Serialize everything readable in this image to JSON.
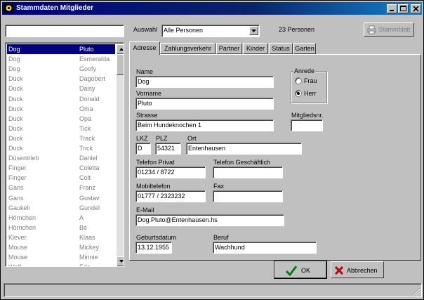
{
  "window": {
    "title": "Stammdaten Mitglieder"
  },
  "toolbar": {
    "search_value": "",
    "auswahl_label": "Auswahl",
    "auswahl_value": "Alle Personen",
    "count_text": "23 Personen",
    "stammblatt_label": "Stammblatt"
  },
  "list": {
    "rows": [
      {
        "last": "Dog",
        "first": "Pluto",
        "selected": true
      },
      {
        "last": "Dog",
        "first": "Esmeralda"
      },
      {
        "last": "Dog",
        "first": "Goofy"
      },
      {
        "last": "Duck",
        "first": "Dagobert"
      },
      {
        "last": "Duck",
        "first": "Daisy"
      },
      {
        "last": "Duck",
        "first": "Donald"
      },
      {
        "last": "Duck",
        "first": "Oma"
      },
      {
        "last": "Duck",
        "first": "Opa"
      },
      {
        "last": "Duck",
        "first": "Tick"
      },
      {
        "last": "Duck",
        "first": "Track"
      },
      {
        "last": "Duck",
        "first": "Trick"
      },
      {
        "last": "Düsentrieb",
        "first": "Daniel"
      },
      {
        "last": "Finger",
        "first": "Coletta"
      },
      {
        "last": "Finger",
        "first": "Colt"
      },
      {
        "last": "Gans",
        "first": "Franz"
      },
      {
        "last": "Gans",
        "first": "Gustav"
      },
      {
        "last": "Gaukeli",
        "first": "Gundel"
      },
      {
        "last": "Hörnchen",
        "first": "A"
      },
      {
        "last": "Hörnchen",
        "first": "Be"
      },
      {
        "last": "Klever",
        "first": "Klaas"
      },
      {
        "last": "Mouse",
        "first": "Mickey"
      },
      {
        "last": "Mouse",
        "first": "Minnie"
      },
      {
        "last": "Wolf",
        "first": "Ede"
      }
    ]
  },
  "tabs": [
    {
      "label": "Adresse",
      "active": true
    },
    {
      "label": "Zahlungsverkehr"
    },
    {
      "label": "Partner"
    },
    {
      "label": "Kinder"
    },
    {
      "label": "Status"
    },
    {
      "label": "Garten"
    }
  ],
  "form": {
    "name_label": "Name",
    "name_value": "Dog",
    "vorname_label": "Vorname",
    "vorname_value": "Pluto",
    "strasse_label": "Strasse",
    "strasse_value": "Beim Hundeknochen 1",
    "lkz_label": "LKZ",
    "lkz_value": "D",
    "plz_label": "PLZ",
    "plz_value": "54321",
    "ort_label": "Ort",
    "ort_value": "Entenhausen",
    "tel_privat_label": "Telefon Privat",
    "tel_privat_value": "01234 / 8722",
    "tel_geschaeft_label": "Telefon Geschäftlich",
    "tel_geschaeft_value": "",
    "mobil_label": "Mobiltelefon",
    "mobil_value": "01777 / 2323232",
    "fax_label": "Fax",
    "fax_value": "",
    "email_label": "E-Mail",
    "email_value": "Dog.Pluto@Entenhausen.hs",
    "geburt_label": "Geburtsdatum",
    "geburt_value": "13.12.1955",
    "beruf_label": "Beruf",
    "beruf_value": "Wachhund",
    "mitgliedsnr_label": "Mitgliedsnr.",
    "mitgliedsnr_value": "",
    "anrede_label": "Anrede",
    "anrede_frau": "Frau",
    "anrede_herr": "Herr",
    "anrede_selected": "Herr"
  },
  "buttons": {
    "ok": "OK",
    "cancel": "Abbrechen"
  },
  "colors": {
    "title_start": "#000080",
    "title_end": "#1084d0",
    "selection": "#000080",
    "ok_check": "#008000",
    "cancel_x": "#c00000"
  }
}
